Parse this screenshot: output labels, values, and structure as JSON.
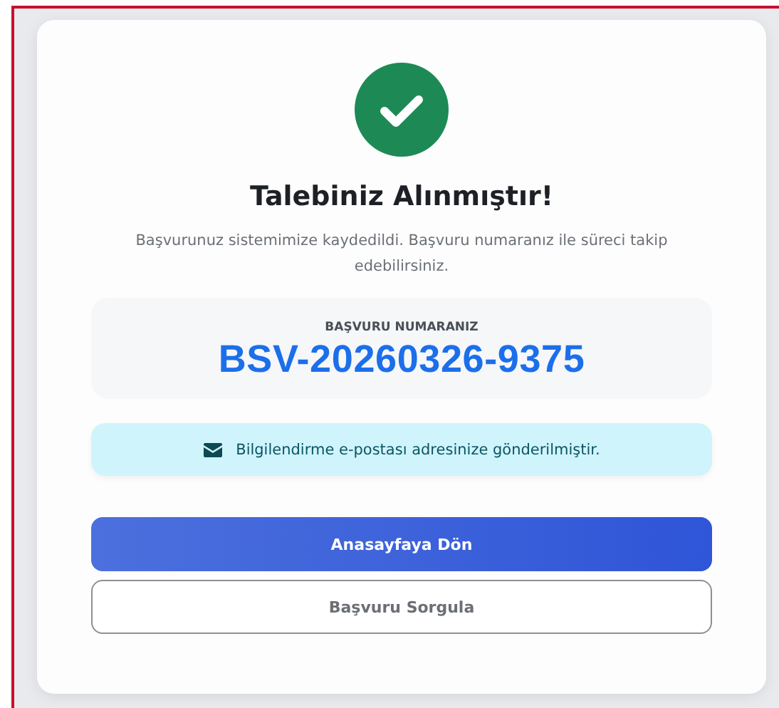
{
  "success": {
    "title": "Talebiniz Alınmıştır!",
    "message": "Başvurunuz sistemimize kaydedildi. Başvuru numaranız ile süreci takip edebilirsiniz."
  },
  "application": {
    "label": "BAŞVURU NUMARANIZ",
    "number": "BSV-20260326-9375"
  },
  "notice": {
    "text": "Bilgilendirme e-postası adresinize gönderilmiştir."
  },
  "buttons": [
    {
      "label": "Anasayfaya Dön",
      "kind": "primary"
    },
    {
      "label": "Başvuru Sorgula",
      "kind": "outline"
    }
  ]
}
